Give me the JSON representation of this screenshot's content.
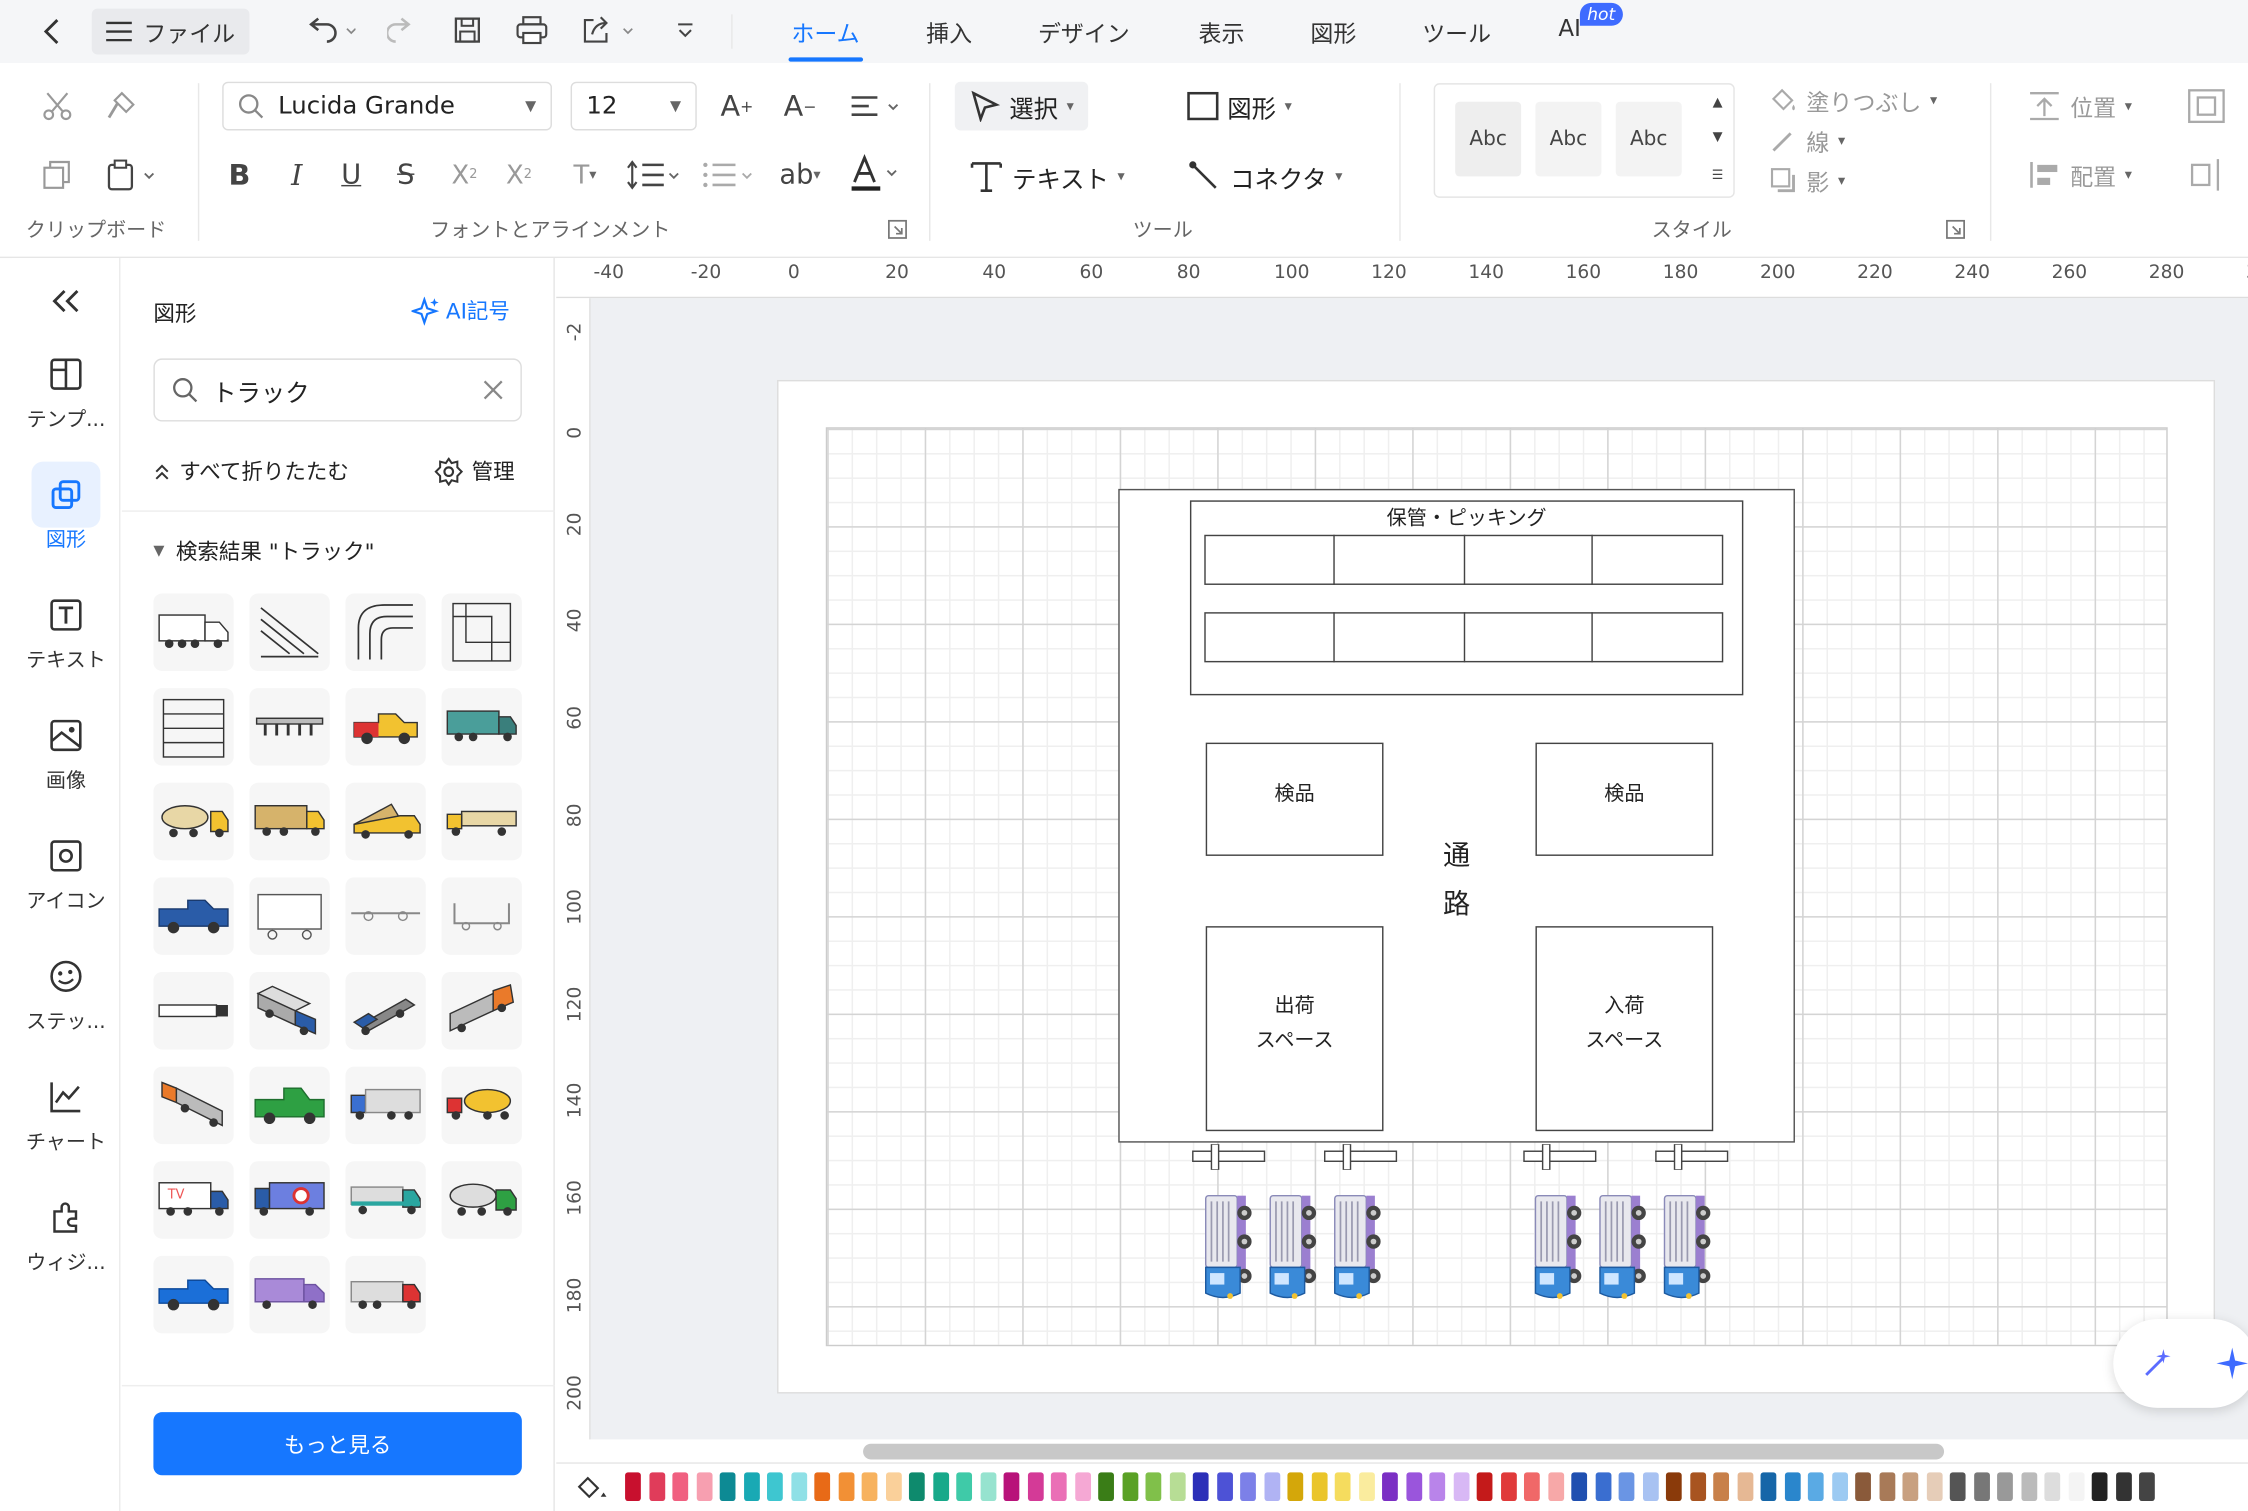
{
  "menu": {
    "file": "ファイル",
    "tabs": [
      "ホーム",
      "挿入",
      "デザイン",
      "表示",
      "図形",
      "ツール",
      "AI"
    ],
    "hot": "hot"
  },
  "ribbon": {
    "font_name": "Lucida Grande",
    "font_size": "12",
    "select": "選択",
    "shape": "図形",
    "text": "テキスト",
    "connector": "コネクタ",
    "style_samples": [
      "Abc",
      "Abc",
      "Abc"
    ],
    "fill": "塗りつぶし",
    "line": "線",
    "shadow": "影",
    "position": "位置",
    "arrange": "配置",
    "group_labels": {
      "clipboard": "クリップボード",
      "font": "フォントとアラインメント",
      "tools": "ツール",
      "style": "スタイル"
    }
  },
  "rail": [
    {
      "label": "テンプ..."
    },
    {
      "label": "図形"
    },
    {
      "label": "テキスト"
    },
    {
      "label": "画像"
    },
    {
      "label": "アイコン"
    },
    {
      "label": "ステッ..."
    },
    {
      "label": "チャート"
    },
    {
      "label": "ウィジ..."
    }
  ],
  "panel": {
    "title": "図形",
    "ai_symbol": "AI記号",
    "search_value": "トラック",
    "collapse_all": "すべて折りたたむ",
    "manage": "管理",
    "results_header": "検索結果 \"トラック\"",
    "more": "もっと見る"
  },
  "ruler_top": [
    "-40",
    "-20",
    "0",
    "20",
    "40",
    "60",
    "80",
    "100",
    "120",
    "140",
    "160",
    "180",
    "200",
    "220",
    "240",
    "260",
    "280",
    "3"
  ],
  "ruler_left": [
    "-2",
    "0",
    "20",
    "40",
    "60",
    "80",
    "100",
    "120",
    "140",
    "160",
    "180",
    "200"
  ],
  "diagram": {
    "storage_title": "保管・ピッキング",
    "inspection_left": "検品",
    "inspection_right": "検品",
    "aisle": [
      "通",
      "路"
    ],
    "shipping": [
      "出荷",
      "スペース"
    ],
    "receiving": [
      "入荷",
      "スペース"
    ]
  },
  "colors": {
    "accent": "#1677ff"
  }
}
